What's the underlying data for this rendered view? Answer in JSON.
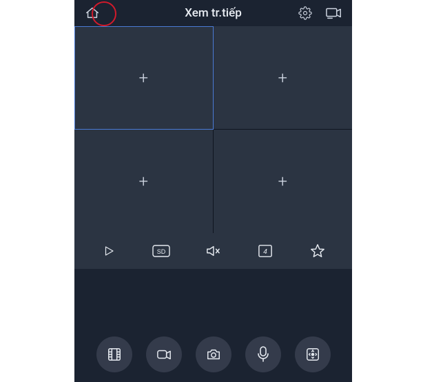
{
  "header": {
    "title": "Xem tr.tiếp",
    "home_icon": "home-icon",
    "settings_icon": "gear-icon",
    "device_icon": "camera-stream-icon"
  },
  "grid": {
    "slots": [
      {
        "selected": true
      },
      {
        "selected": false
      },
      {
        "selected": false
      },
      {
        "selected": false
      }
    ],
    "add_label": "+"
  },
  "toolbar": {
    "play_label": "play",
    "quality_label": "SD",
    "mute_label": "muted",
    "layout_label": "4",
    "favorite_label": "star"
  },
  "dock": {
    "playback_label": "playback",
    "record_label": "record",
    "snapshot_label": "snapshot",
    "mic_label": "mic",
    "ptz_label": "ptz"
  },
  "annotation": {
    "highlight": "home-button-circle"
  }
}
